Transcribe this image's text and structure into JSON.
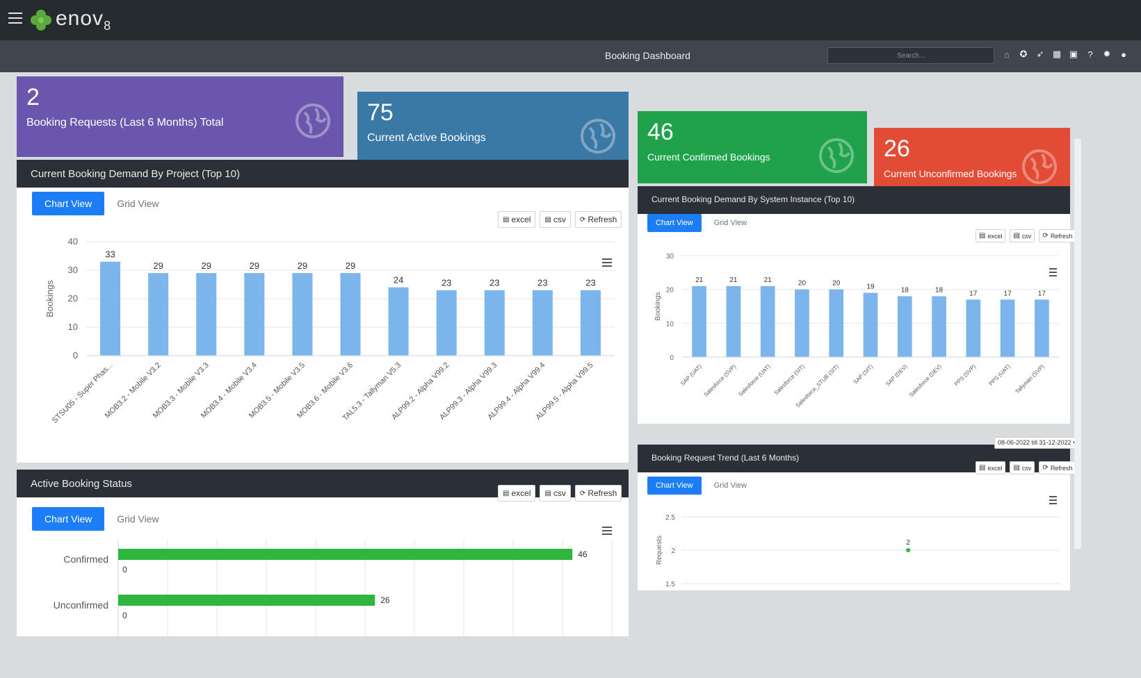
{
  "header": {
    "logo_text": "enov",
    "logo_suffix": "8",
    "page_title": "Booking Dashboard",
    "search_placeholder": "Search..."
  },
  "kpis": [
    {
      "value": "2",
      "label": "Booking Requests (Last 6 Months) Total",
      "color": "#6a57ad"
    },
    {
      "value": "75",
      "label": "Current Active Bookings",
      "color": "#3a78a6"
    },
    {
      "value": "46",
      "label": "Current Confirmed Bookings",
      "color": "#1fa24c"
    },
    {
      "value": "26",
      "label": "Current Unconfirmed Bookings",
      "color": "#e24c36"
    }
  ],
  "common": {
    "chart_view": "Chart View",
    "grid_view": "Grid View",
    "excel": "excel",
    "csv": "csv",
    "refresh": "Refresh"
  },
  "panels": {
    "project": {
      "title": "Current Booking Demand By Project (Top 10)"
    },
    "system": {
      "title": "Current Booking Demand By System Instance (Top 10)"
    },
    "status": {
      "title": "Active Booking Status"
    },
    "trend": {
      "title": "Booking Request Trend (Last 6 Months)",
      "date_range": "08-06-2022 till 31-12-2022 ▾"
    }
  },
  "chart_data": [
    {
      "type": "bar",
      "ylabel": "Bookings",
      "ylim": [
        0,
        40
      ],
      "yticks": [
        0,
        10,
        20,
        30,
        40
      ],
      "categories": [
        "STSU05 - Super Phas...",
        "MOB3.2 - Mobile V3.2",
        "MOB3.3 - Mobile V3.3",
        "MOB3.4 - Mobile V3.4",
        "MOB3.5 - Mobile V3.5",
        "MOB3.6 - Mobile V3.6",
        "TAL5.3 - Tallyman V5.3",
        "ALP99.2 - Alpha V99.2",
        "ALP99.3 - Alpha V99.3",
        "ALP99.4 - Alpha V99.4",
        "ALP99.5 - Alpha V99.5"
      ],
      "values": [
        33,
        29,
        29,
        29,
        29,
        29,
        24,
        23,
        23,
        23,
        23
      ],
      "color": "#7cb5ec"
    },
    {
      "type": "bar",
      "ylabel": "Bookings",
      "ylim": [
        0,
        30
      ],
      "yticks": [
        0,
        10,
        20,
        30
      ],
      "categories": [
        "SAP (UAT)",
        "Salesforce (SVP)",
        "Salesforce (UAT)",
        "Salesforce (SIT)",
        "Salesforce_STUB (SIT)",
        "SAP (SIT)",
        "SAP (DEV)",
        "Salesforce (DEV)",
        "PPS (SVP)",
        "PPS (UAT)",
        "Tallyman (SVP)"
      ],
      "values": [
        21,
        21,
        21,
        20,
        20,
        19,
        18,
        18,
        17,
        17,
        17
      ],
      "color": "#7cb5ec"
    },
    {
      "type": "bar",
      "orientation": "horizontal",
      "categories": [
        "Confirmed",
        "Unconfirmed"
      ],
      "values": [
        46,
        26
      ],
      "xlim": [
        0,
        50
      ],
      "start_label": "0",
      "color": "#2db83d"
    },
    {
      "type": "scatter",
      "ylabel": "Requests",
      "yticks": [
        "1.5",
        "2",
        "2.5"
      ],
      "ylim": [
        1.5,
        2.5
      ],
      "points": [
        {
          "y": 2,
          "label": "2"
        }
      ],
      "color": "#2db83d"
    }
  ]
}
